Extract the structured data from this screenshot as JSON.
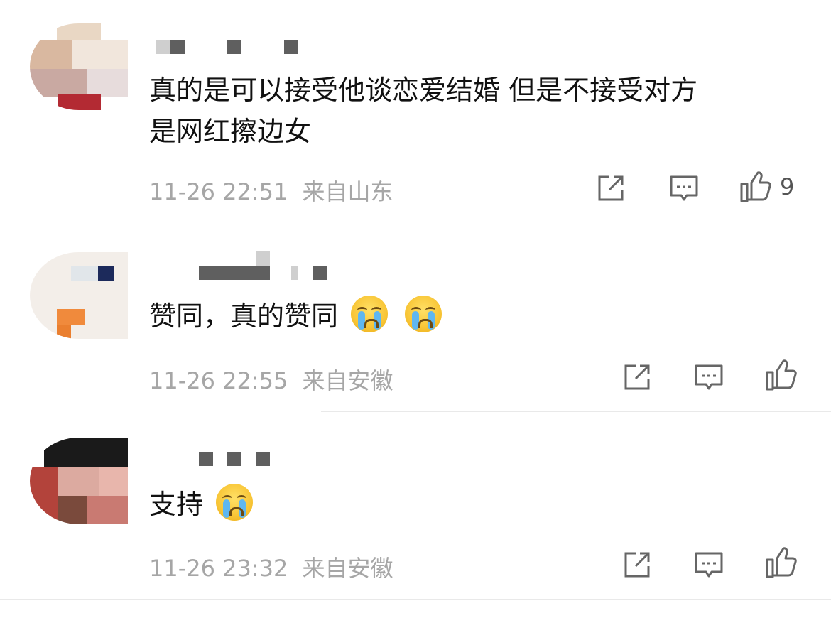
{
  "comments": [
    {
      "text_line1": "真的是可以接受他谈恋爱结婚 但是不接受对方",
      "text_line2": "是网红擦边女",
      "time": "11-26 22:51",
      "location": "来自山东",
      "like_count": "9",
      "emoji_count": 0
    },
    {
      "text_line1": "赞同，真的赞同",
      "time": "11-26 22:55",
      "location": "来自安徽",
      "like_count": "",
      "emoji_count": 2,
      "emoji": "loudly-crying-face"
    },
    {
      "text_line1": "支持",
      "time": "11-26 23:32",
      "location": "来自安徽",
      "like_count": "",
      "emoji_count": 1,
      "emoji": "loudly-crying-face"
    }
  ],
  "icons": {
    "share": "share-icon",
    "reply": "comment-icon",
    "like": "thumbs-up-icon"
  },
  "colors": {
    "text": "#111111",
    "meta": "#a6a6a6",
    "icon": "#666666",
    "divider": "#e9e9e9"
  }
}
